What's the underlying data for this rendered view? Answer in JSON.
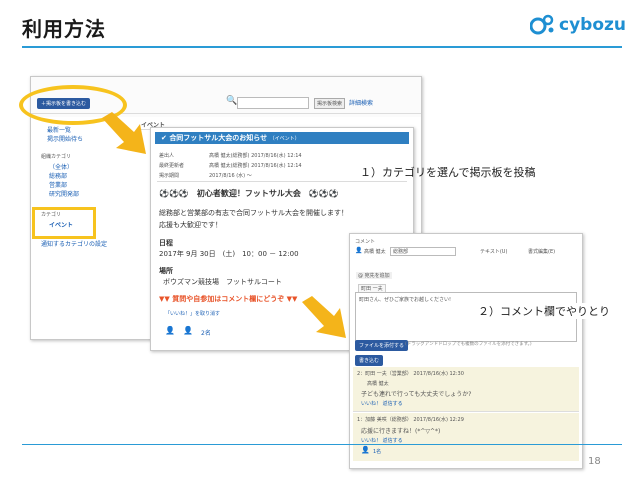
{
  "slide": {
    "title": "利用方法",
    "logo_text": "cybozu",
    "page_number": "18"
  },
  "annotations": {
    "step1": "１）カテゴリを選んで掲示板を投稿",
    "step2": "２）コメント欄でやりとり"
  },
  "board": {
    "new_post_button": "掲示板を書き込む",
    "search_button": "掲示板検索",
    "advanced_search": "詳細検索",
    "sidebar_items": [
      "最新一覧",
      "掲示開始待ち"
    ],
    "category_heading": "組織カテゴリ",
    "category_items": [
      "（全体）",
      "総務部",
      "営業部",
      "研究開発部"
    ],
    "category2_heading": "カテゴリ",
    "category2_selected": "イベント",
    "notify_link": "通知するカテゴリの設定",
    "section_label": "イベント"
  },
  "post": {
    "title": "合同フットサル大会のお知らせ",
    "category_tag": "（イベント）",
    "author_label": "差出人",
    "author": "高橋 健太(総務部) 2017/8/16(水) 12:14",
    "editor_label": "最終更新者",
    "editor": "高橋 健太(総務部) 2017/8/16(水) 12:14",
    "period_label": "掲示期間",
    "period": "2017/8/16 (水) ～",
    "headline": "⚽⚽⚽　初心者歓迎！フットサル大会　⚽⚽⚽",
    "body1": "総務部と営業部の有志で合同フットサル大会を開催します！",
    "body2": "応援も大歓迎です！",
    "date_heading": "日程",
    "date": "2017年 9月 30日　(土)　10：00 － 12:00",
    "place_heading": "場所",
    "place": "ボウズマン競技場　フットサルコート",
    "notice": "▼▼ 質問や自参加はコメント欄にどうぞ ▼▼",
    "like": "「いいね！」を取り消す",
    "like_count": "2名"
  },
  "comment_panel": {
    "heading": "コメント",
    "commenter": "高橋 健太",
    "org": "総務部",
    "format_text": "テキスト(U)",
    "format_rich": "書式編集(E)",
    "mention_label": "@ 宛先を追加",
    "mention_user": "町田 一夫",
    "draft": "町田さん、ぜひご家族でお越しください!",
    "attach_button": "ファイルを添付する",
    "attach_hint": "(ドラッグアンドドロップでも複数のファイルを添付できます。)",
    "submit_button": "書き込む",
    "comments": [
      {
        "header": "2：町田 一夫（営業部） 2017/8/16(水) 12:30",
        "mention": "高橋 健太",
        "text": "子ども連れで行っても大丈夫でしょうか?",
        "actions": "いいね！  返信する"
      },
      {
        "header": "1：加藤 美咲（総務部） 2017/8/16(水) 12:29",
        "text": "応援に行きますね！(*^▽^*)",
        "actions": "いいね！  返信する",
        "like_count": "1名"
      }
    ]
  },
  "colors": {
    "accent": "#2a9bd6",
    "highlight": "#f7c31e",
    "arrow": "#f4b41a",
    "post_header": "#2f7fc1",
    "comment_bg": "#f6f3de"
  }
}
